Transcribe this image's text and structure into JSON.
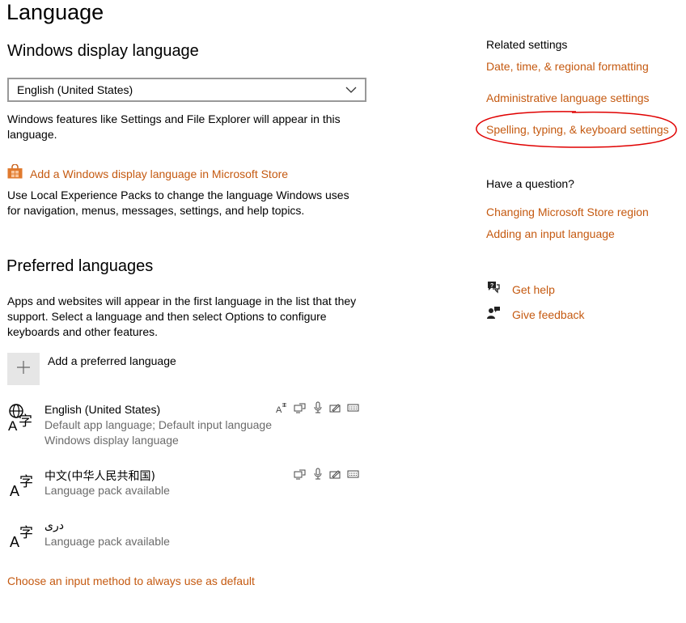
{
  "page": {
    "title": "Language"
  },
  "display_language": {
    "heading": "Windows display language",
    "selected": "English (United States)",
    "description": "Windows features like Settings and File Explorer will appear in this language.",
    "store_link": "Add a Windows display language in Microsoft Store",
    "lxp_description": "Use Local Experience Packs to change the language Windows uses for navigation, menus, messages, settings, and help topics."
  },
  "preferred": {
    "heading": "Preferred languages",
    "description": "Apps and websites will appear in the first language in the list that they support. Select a language and then select Options to configure keyboards and other features.",
    "add_label": "Add a preferred language",
    "languages": [
      {
        "name": "English (United States)",
        "line1": "Default app language; Default input language",
        "line2": "Windows display language"
      },
      {
        "name": "中文(中华人民共和国)",
        "line1": "Language pack available"
      },
      {
        "name": "دری",
        "line1": "Language pack available"
      }
    ],
    "input_method_link": "Choose an input method to always use as default"
  },
  "related": {
    "heading": "Related settings",
    "links": [
      "Date, time, & regional formatting",
      "Administrative language settings",
      "Spelling, typing, & keyboard settings"
    ]
  },
  "question": {
    "heading": "Have a question?",
    "links": [
      "Changing Microsoft Store region",
      "Adding an input language"
    ]
  },
  "help": {
    "get_help": "Get help",
    "give_feedback": "Give feedback"
  },
  "colors": {
    "accent": "#c55a11",
    "annotation": "#e00000"
  }
}
